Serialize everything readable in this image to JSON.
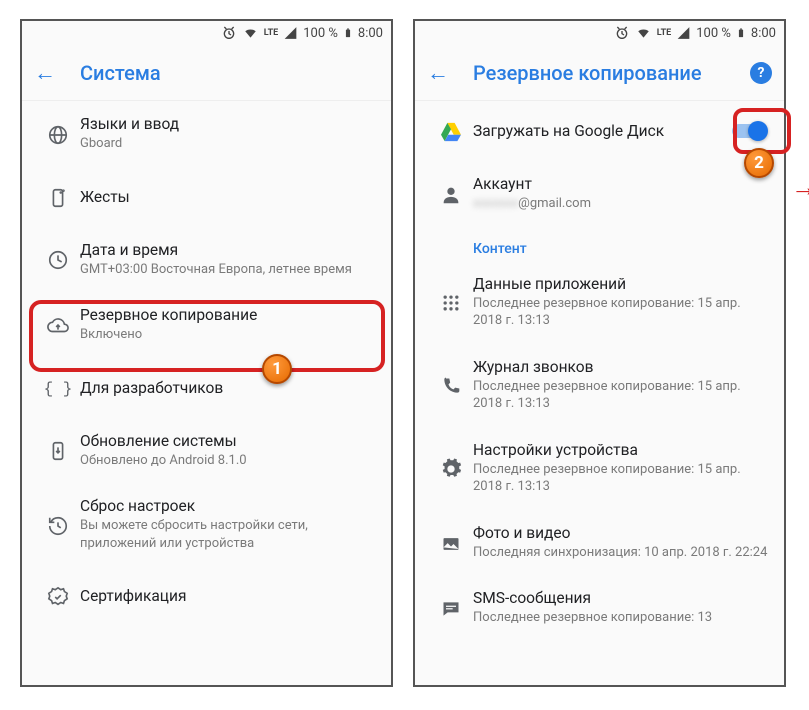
{
  "status": {
    "battery": "100 %",
    "time": "8:00",
    "lte": "LTE"
  },
  "left": {
    "title": "Система",
    "items": [
      {
        "title": "Языки и ввод",
        "sub": "Gboard"
      },
      {
        "title": "Жесты",
        "sub": ""
      },
      {
        "title": "Дата и время",
        "sub": "GMT+03:00 Восточная Европа, летнее время"
      },
      {
        "title": "Резервное копирование",
        "sub": "Включено"
      },
      {
        "title": "Для разработчиков",
        "sub": ""
      },
      {
        "title": "Обновление системы",
        "sub": "Обновлено до Android 8.1.0"
      },
      {
        "title": "Сброс настроек",
        "sub": "Вы можете сбросить настройки сети, приложений или устройства"
      },
      {
        "title": "Сертификация",
        "sub": ""
      }
    ]
  },
  "right": {
    "title": "Резервное копирование",
    "upload": "Загружать на Google Диск",
    "account": {
      "label": "Аккаунт",
      "email_hidden": "xxxxxxx",
      "email_domain": "@gmail.com"
    },
    "section": "Контент",
    "items": [
      {
        "title": "Данные приложений",
        "sub": "Последнее резервное копирование: 15 апр. 2018 г. 13:13"
      },
      {
        "title": "Журнал звонков",
        "sub": "Последнее резервное копирование: 15 апр. 2018 г. 13:13"
      },
      {
        "title": "Настройки устройства",
        "sub": "Последнее резервное копирование: 15 апр. 2018 г. 13:13"
      },
      {
        "title": "Фото и видео",
        "sub": "Последняя синхронизация: 10 апр. 2018 г. 22:24"
      },
      {
        "title": "SMS-сообщения",
        "sub": "Последнее резервное копирование: 13"
      }
    ]
  },
  "callouts": {
    "one": "1",
    "two": "2"
  }
}
